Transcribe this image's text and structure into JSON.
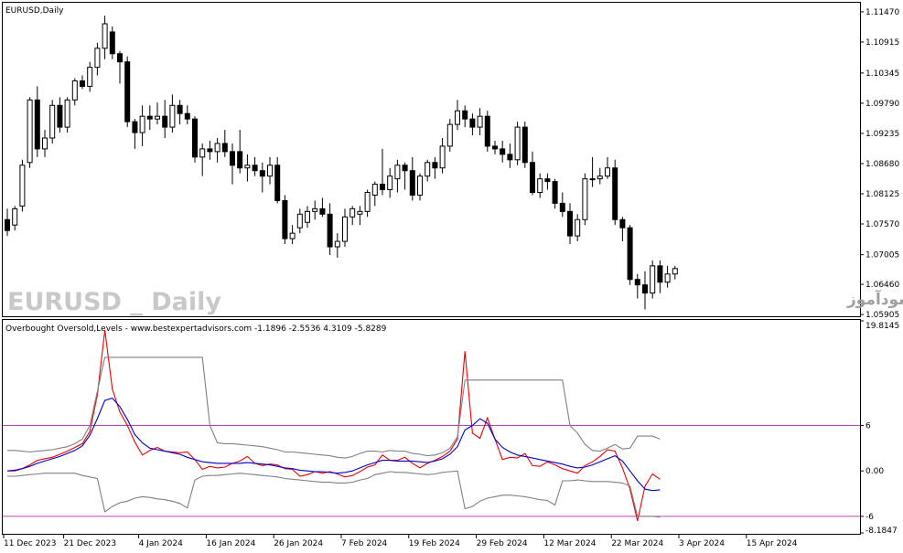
{
  "window": {
    "symbol_title": "EURUSD,Daily",
    "watermark_symbol": "EURUSD _ Daily",
    "watermark_site": "انتشار در سایت سودآموز"
  },
  "indicator": {
    "title": "Overbought Oversold,Levels - www.bestexpertadvisors.com -1.1896 -2.5536 4.3109 -5.8289",
    "levels_labels": [
      "19.8145",
      "6",
      "0.00",
      "-6",
      "-8.1847"
    ]
  },
  "colors": {
    "bull": "#ffffff",
    "bear": "#000000",
    "main_line": "#ee0000",
    "signal_line": "#0000cc",
    "band_line": "#808080",
    "level_line": "#bb44bb"
  },
  "chart_data": [
    {
      "type": "candlestick",
      "title": "EURUSD,Daily",
      "ylim": [
        1.0589,
        1.1162
      ],
      "yticks": [
        1.1147,
        1.10915,
        1.10345,
        1.0979,
        1.09235,
        1.0868,
        1.08125,
        1.0757,
        1.07005,
        1.0646,
        1.05905
      ],
      "ytick_labels": [
        "1.11470",
        "1.10915",
        "1.10345",
        "1.09790",
        "1.09235",
        "1.08680",
        "1.08125",
        "1.07570",
        "1.07005",
        "1.06460",
        "1.05905"
      ],
      "candles": [
        [
          1.0765,
          1.0785,
          1.0735,
          1.0745
        ],
        [
          1.0755,
          1.079,
          1.0745,
          1.0785
        ],
        [
          1.079,
          1.0875,
          1.078,
          1.0865
        ],
        [
          1.087,
          1.099,
          1.086,
          1.0985
        ],
        [
          1.0985,
          1.101,
          1.088,
          1.0895
        ],
        [
          1.0895,
          1.093,
          1.088,
          1.0915
        ],
        [
          1.0915,
          1.0985,
          1.0905,
          1.0975
        ],
        [
          1.0975,
          1.099,
          1.0925,
          1.0935
        ],
        [
          1.0935,
          1.099,
          1.0925,
          1.0985
        ],
        [
          1.0985,
          1.1025,
          1.0975,
          1.102
        ],
        [
          1.102,
          1.103,
          1.1005,
          1.101
        ],
        [
          1.101,
          1.1055,
          1.1,
          1.1045
        ],
        [
          1.1045,
          1.109,
          1.103,
          1.108
        ],
        [
          1.108,
          1.114,
          1.106,
          1.1125
        ],
        [
          1.111,
          1.112,
          1.106,
          1.107
        ],
        [
          1.107,
          1.1075,
          1.1015,
          1.1055
        ],
        [
          1.1055,
          1.1065,
          1.0935,
          1.0945
        ],
        [
          1.0945,
          1.095,
          1.0895,
          1.0925
        ],
        [
          1.0925,
          1.0975,
          1.09,
          1.0955
        ],
        [
          1.0955,
          1.0975,
          1.093,
          1.095
        ],
        [
          1.095,
          1.098,
          1.094,
          1.0955
        ],
        [
          1.0955,
          1.0985,
          1.0915,
          1.0935
        ],
        [
          1.0935,
          1.0995,
          1.0925,
          1.0975
        ],
        [
          1.0975,
          1.0985,
          1.094,
          1.096
        ],
        [
          1.096,
          1.0975,
          1.094,
          1.095
        ],
        [
          1.095,
          1.0955,
          1.087,
          1.088
        ],
        [
          1.088,
          1.0905,
          1.0845,
          1.0895
        ],
        [
          1.0895,
          1.091,
          1.0875,
          1.089
        ],
        [
          1.089,
          1.0915,
          1.087,
          1.0905
        ],
        [
          1.0905,
          1.093,
          1.088,
          1.089
        ],
        [
          1.089,
          1.0905,
          1.083,
          1.0865
        ],
        [
          1.089,
          1.093,
          1.085,
          1.086
        ],
        [
          1.086,
          1.0885,
          1.0835,
          1.0865
        ],
        [
          1.0865,
          1.088,
          1.0845,
          1.0855
        ],
        [
          1.0855,
          1.087,
          1.0815,
          1.0845
        ],
        [
          1.0845,
          1.088,
          1.083,
          1.0865
        ],
        [
          1.0865,
          1.088,
          1.0795,
          1.08
        ],
        [
          1.08,
          1.081,
          1.072,
          1.073
        ],
        [
          1.073,
          1.0755,
          1.072,
          1.074
        ],
        [
          1.075,
          1.0785,
          1.074,
          1.0775
        ],
        [
          1.076,
          1.079,
          1.075,
          1.078
        ],
        [
          1.078,
          1.08,
          1.0765,
          1.0785
        ],
        [
          1.0785,
          1.0805,
          1.077,
          1.0775
        ],
        [
          1.0775,
          1.0795,
          1.07,
          1.0715
        ],
        [
          1.0715,
          1.074,
          1.0695,
          1.0725
        ],
        [
          1.0725,
          1.0785,
          1.0715,
          1.077
        ],
        [
          1.077,
          1.079,
          1.0755,
          1.0785
        ],
        [
          1.0775,
          1.079,
          1.0755,
          1.078
        ],
        [
          1.078,
          1.082,
          1.077,
          1.0815
        ],
        [
          1.081,
          1.0835,
          1.079,
          1.083
        ],
        [
          1.083,
          1.0895,
          1.081,
          1.082
        ],
        [
          1.082,
          1.086,
          1.0805,
          1.0845
        ],
        [
          1.084,
          1.0875,
          1.0815,
          1.0865
        ],
        [
          1.0865,
          1.087,
          1.082,
          1.0855
        ],
        [
          1.0855,
          1.088,
          1.08,
          1.081
        ],
        [
          1.081,
          1.085,
          1.08,
          1.0845
        ],
        [
          1.0845,
          1.0875,
          1.0835,
          1.087
        ],
        [
          1.087,
          1.088,
          1.084,
          1.086
        ],
        [
          1.086,
          1.0915,
          1.085,
          1.09
        ],
        [
          1.09,
          1.095,
          1.089,
          1.094
        ],
        [
          1.094,
          1.0985,
          1.093,
          1.0965
        ],
        [
          1.0965,
          1.0975,
          1.0935,
          1.095
        ],
        [
          1.095,
          1.096,
          1.092,
          1.0935
        ],
        [
          1.0935,
          1.097,
          1.092,
          1.0955
        ],
        [
          1.0955,
          1.0965,
          1.089,
          1.09
        ],
        [
          1.09,
          1.091,
          1.0885,
          1.0895
        ],
        [
          1.0895,
          1.091,
          1.087,
          1.0885
        ],
        [
          1.0885,
          1.0905,
          1.086,
          1.0875
        ],
        [
          1.0875,
          1.0945,
          1.0865,
          1.0935
        ],
        [
          1.0935,
          1.0945,
          1.086,
          1.087
        ],
        [
          1.087,
          1.089,
          1.081,
          1.0815
        ],
        [
          1.0815,
          1.085,
          1.0805,
          1.084
        ],
        [
          1.084,
          1.085,
          1.082,
          1.0835
        ],
        [
          1.0835,
          1.084,
          1.0785,
          1.0795
        ],
        [
          1.0795,
          1.0815,
          1.077,
          1.078
        ],
        [
          1.078,
          1.0795,
          1.072,
          1.0735
        ],
        [
          1.0735,
          1.0775,
          1.0725,
          1.0765
        ],
        [
          1.0765,
          1.085,
          1.0755,
          1.084
        ],
        [
          1.084,
          1.088,
          1.0825,
          1.084
        ],
        [
          1.084,
          1.086,
          1.083,
          1.0845
        ],
        [
          1.0845,
          1.088,
          1.084,
          1.086
        ],
        [
          1.086,
          1.0875,
          1.0755,
          1.0765
        ],
        [
          1.0765,
          1.077,
          1.0725,
          1.075
        ],
        [
          1.075,
          1.0755,
          1.0645,
          1.0655
        ],
        [
          1.0655,
          1.0665,
          1.062,
          1.0645
        ],
        [
          1.0645,
          1.067,
          1.06,
          1.063
        ],
        [
          1.063,
          1.069,
          1.062,
          1.068
        ],
        [
          1.068,
          1.069,
          1.063,
          1.065
        ],
        [
          1.065,
          1.068,
          1.064,
          1.0665
        ],
        [
          1.0665,
          1.068,
          1.0655,
          1.0675
        ]
      ]
    },
    {
      "type": "line",
      "title": "Overbought Oversold,Levels - www.bestexpertadvisors.com -1.1896 -2.5536 4.3109 -5.8289",
      "ylim": [
        -8.1847,
        19.8145
      ],
      "levels": [
        6,
        -6
      ],
      "xtick_labels": [
        "11 Dec 2023",
        "21 Dec 2023",
        "4 Jan 2024",
        "16 Jan 2024",
        "26 Jan 2024",
        "7 Feb 2024",
        "19 Feb 2024",
        "29 Feb 2024",
        "12 Mar 2024",
        "22 Mar 2024",
        "3 Apr 2024",
        "15 Apr 2024"
      ],
      "xtick_index": [
        0,
        8,
        18,
        27,
        36,
        45,
        54,
        63,
        72,
        81,
        90,
        99
      ],
      "series": [
        {
          "role": "main",
          "values": [
            0.0,
            0.0,
            0.3,
            0.8,
            1.4,
            1.6,
            1.8,
            2.2,
            2.6,
            3.1,
            3.6,
            5.2,
            10.0,
            18.6,
            10.8,
            7.8,
            6.0,
            3.8,
            2.1,
            2.7,
            3.1,
            2.6,
            2.5,
            2.4,
            2.5,
            1.5,
            0.2,
            0.6,
            0.4,
            0.5,
            1.0,
            1.3,
            1.9,
            1.0,
            0.7,
            0.9,
            0.8,
            0.3,
            0.2,
            -0.7,
            -0.5,
            -0.1,
            -0.3,
            -0.1,
            -0.4,
            -0.8,
            -0.6,
            -0.1,
            0.5,
            0.8,
            2.1,
            1.4,
            1.4,
            1.8,
            1.0,
            0.4,
            1.0,
            1.4,
            1.9,
            2.6,
            4.2,
            15.8,
            5.0,
            4.3,
            7.0,
            4.2,
            1.5,
            1.8,
            1.7,
            2.3,
            0.7,
            0.6,
            1.2,
            0.8,
            0.3,
            0.0,
            -0.3,
            0.7,
            1.2,
            1.9,
            2.8,
            2.6,
            0.4,
            -2.4,
            -6.6,
            -2.0,
            -0.4,
            -1.1
          ],
          "color_role": "main_line"
        },
        {
          "role": "signal",
          "values": [
            0.0,
            0.1,
            0.3,
            0.6,
            1.0,
            1.3,
            1.6,
            1.9,
            2.3,
            2.7,
            3.3,
            4.7,
            6.9,
            9.3,
            9.6,
            8.5,
            6.8,
            4.8,
            3.7,
            3.0,
            2.8,
            2.6,
            2.4,
            2.2,
            1.8,
            1.5,
            1.2,
            1.1,
            1.0,
            1.0,
            1.0,
            1.0,
            1.1,
            1.0,
            0.9,
            0.8,
            0.6,
            0.4,
            0.3,
            0.1,
            0.0,
            -0.1,
            -0.1,
            -0.2,
            -0.3,
            -0.2,
            0.0,
            0.4,
            0.8,
            1.1,
            1.4,
            1.4,
            1.3,
            1.3,
            1.3,
            1.2,
            1.1,
            1.3,
            1.6,
            2.2,
            3.2,
            5.4,
            6.0,
            6.9,
            6.3,
            4.2,
            3.1,
            2.5,
            2.1,
            1.9,
            1.7,
            1.5,
            1.3,
            1.1,
            0.9,
            0.6,
            0.4,
            0.5,
            0.8,
            1.2,
            1.6,
            2.0,
            1.3,
            0.0,
            -1.3,
            -2.4,
            -2.6,
            -2.5
          ],
          "color_role": "signal_line"
        },
        {
          "role": "upper_band",
          "values": [
            2.7,
            2.7,
            2.6,
            2.5,
            2.6,
            2.7,
            2.8,
            3.0,
            3.2,
            3.6,
            4.2,
            6.0,
            10.5,
            15.0,
            15.0,
            15.0,
            15.0,
            15.0,
            15.0,
            15.0,
            15.0,
            15.0,
            15.0,
            15.0,
            15.0,
            15.0,
            15.0,
            6.0,
            3.7,
            3.6,
            3.6,
            3.5,
            3.4,
            3.3,
            3.2,
            3.0,
            2.8,
            2.5,
            2.5,
            2.4,
            2.3,
            2.2,
            2.1,
            2.0,
            1.8,
            1.7,
            1.9,
            2.3,
            2.6,
            2.6,
            2.5,
            2.7,
            2.6,
            2.6,
            2.3,
            2.2,
            2.0,
            2.1,
            2.4,
            3.0,
            4.5,
            12.0,
            12.0,
            12.0,
            12.0,
            12.0,
            12.0,
            12.0,
            12.0,
            12.0,
            12.0,
            12.0,
            12.0,
            12.0,
            12.0,
            6.0,
            5.0,
            3.5,
            2.7,
            2.6,
            3.0,
            3.5,
            2.9,
            3.0,
            4.6,
            4.6,
            4.6,
            4.2
          ],
          "color_role": "band_line"
        },
        {
          "role": "lower_band",
          "values": [
            -0.7,
            -0.7,
            -0.6,
            -0.5,
            -0.4,
            -0.3,
            -0.3,
            -0.3,
            -0.3,
            -0.3,
            -0.6,
            -0.8,
            -1.0,
            -5.4,
            -4.7,
            -4.2,
            -4.0,
            -3.6,
            -3.4,
            -3.5,
            -3.7,
            -3.8,
            -4.0,
            -4.3,
            -4.9,
            -1.2,
            -0.7,
            -0.6,
            -0.6,
            -0.5,
            -0.4,
            -0.3,
            -0.4,
            -0.5,
            -0.6,
            -0.7,
            -0.8,
            -1.0,
            -1.1,
            -1.2,
            -1.3,
            -1.4,
            -1.5,
            -1.5,
            -1.6,
            -1.6,
            -1.5,
            -1.2,
            -1.0,
            -0.5,
            -0.3,
            -0.1,
            -0.2,
            -0.2,
            -0.3,
            -0.4,
            -0.5,
            -0.4,
            -0.2,
            -0.1,
            0.0,
            -5.0,
            -4.7,
            -4.0,
            -3.6,
            -3.4,
            -3.2,
            -3.2,
            -3.3,
            -3.4,
            -3.6,
            -3.8,
            -3.9,
            -4.5,
            -1.3,
            -1.3,
            -1.2,
            -1.3,
            -1.4,
            -1.4,
            -1.4,
            -1.5,
            -1.6,
            -2.0,
            -6.0,
            -6.0,
            -6.0,
            -6.1
          ],
          "color_role": "band_line"
        }
      ]
    }
  ]
}
